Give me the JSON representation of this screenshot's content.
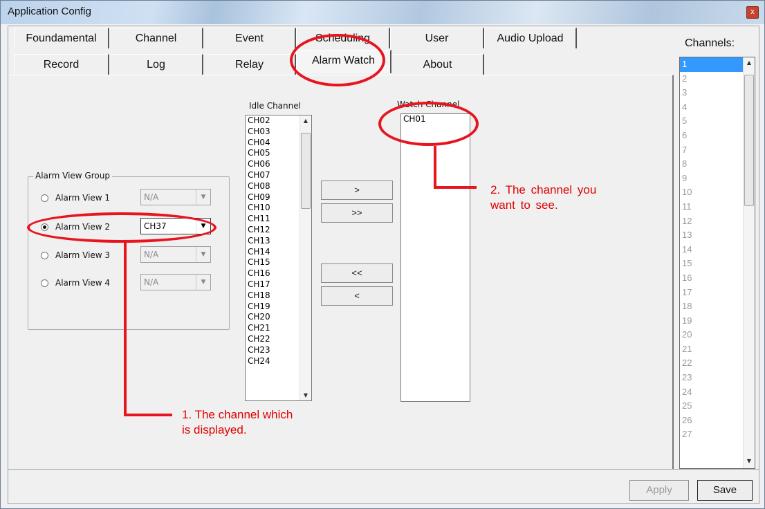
{
  "window": {
    "title": "Application Config",
    "close_glyph": "x"
  },
  "tabs_row1": [
    "Foundamental",
    "Channel",
    "Event",
    "Scheduling",
    "User",
    "Audio Upload"
  ],
  "tabs_row2": [
    "Record",
    "Log",
    "Relay",
    "Alarm Watch",
    "About"
  ],
  "active_tab": "Alarm Watch",
  "alarm_group": {
    "label": "Alarm View Group",
    "views": [
      {
        "label": "Alarm View 1",
        "value": "N/A",
        "selected": false
      },
      {
        "label": "Alarm View 2",
        "value": "CH37",
        "selected": true
      },
      {
        "label": "Alarm View 3",
        "value": "N/A",
        "selected": false
      },
      {
        "label": "Alarm View 4",
        "value": "N/A",
        "selected": false
      }
    ]
  },
  "idle_channel": {
    "label": "Idle Channel",
    "items": [
      "CH02",
      "CH03",
      "CH04",
      "CH05",
      "CH06",
      "CH07",
      "CH08",
      "CH09",
      "CH10",
      "CH11",
      "CH12",
      "CH13",
      "CH14",
      "CH15",
      "CH16",
      "CH17",
      "CH18",
      "CH19",
      "CH20",
      "CH21",
      "CH22",
      "CH23",
      "CH24"
    ]
  },
  "watch_channel": {
    "label": "Watch Channel",
    "items": [
      "CH01"
    ]
  },
  "move_buttons": {
    "add": ">",
    "add_all": ">>",
    "remove_all": "<<",
    "remove": "<"
  },
  "channels": {
    "label": "Channels:",
    "items": [
      "1",
      "2",
      "3",
      "4",
      "5",
      "6",
      "7",
      "8",
      "9",
      "10",
      "11",
      "12",
      "13",
      "14",
      "15",
      "16",
      "17",
      "18",
      "19",
      "20",
      "21",
      "22",
      "23",
      "24",
      "25",
      "26",
      "27"
    ],
    "selected": "1"
  },
  "footer": {
    "apply": "Apply",
    "save": "Save"
  },
  "annotations": {
    "note1_line1": "1. The channel which",
    "note1_line2": "is displayed.",
    "note2_line1": "2.  The  channel  you",
    "note2_line2": "want to see."
  },
  "colors": {
    "annotation": "#e8141e",
    "selection": "#3399ff"
  }
}
